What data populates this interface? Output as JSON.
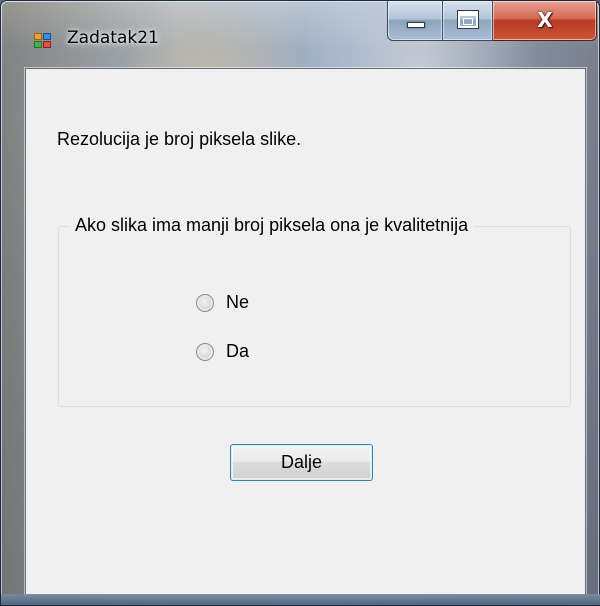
{
  "window": {
    "title": "Zadatak21",
    "icon": "winforms-app-icon",
    "close_glyph": "X"
  },
  "question": {
    "statement": "Rezolucija je broj piksela slike.",
    "group_title": "Ako slika ima manji broj piksela ona je kvalitetnija",
    "options": [
      {
        "label": "Ne",
        "selected": false
      },
      {
        "label": "Da",
        "selected": false
      }
    ]
  },
  "actions": {
    "next_label": "Dalje"
  },
  "colors": {
    "client_background": "#f0f0f0",
    "close_button": "#c9553b",
    "button_focus_border": "#3c7fb1"
  }
}
